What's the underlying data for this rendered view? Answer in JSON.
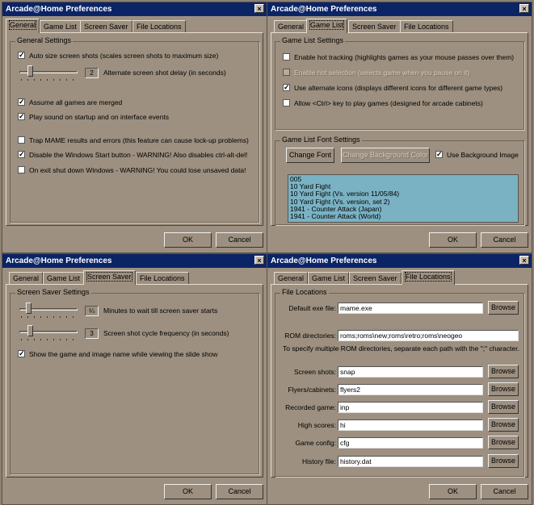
{
  "window_title": "Arcade@Home Preferences",
  "close_glyph": "×",
  "tabs": [
    "General",
    "Game List",
    "Screen Saver",
    "File Locations"
  ],
  "ok_label": "OK",
  "cancel_label": "Cancel",
  "general": {
    "group_title": "General Settings",
    "autosize": {
      "label": "Auto size screen shots (scales screen shots to maximum size)",
      "checked": true
    },
    "delay_value": "2",
    "delay_label": "Alternate screen shot delay (in seconds)",
    "merged": {
      "label": "Assume all games are merged",
      "checked": true
    },
    "sound": {
      "label": "Play sound on startup and on interface events",
      "checked": true
    },
    "trap": {
      "label": "Trap MAME results and errors (this feature can cause lock-up problems)",
      "checked": false
    },
    "winstart": {
      "label": "Disable the Windows Start button - WARNING! Also disables ctrl-alt-del!",
      "checked": true
    },
    "shutdown": {
      "label": "On exit shut down Windows - WARNING! You could lose unsaved data!",
      "checked": false
    }
  },
  "gamelist": {
    "group_title": "Game List Settings",
    "hot": {
      "label": "Enable hot tracking (highlights games as your mouse passes over them)",
      "checked": false
    },
    "hotsel": {
      "label": "Enable hot selection (selects game when you pause on it)",
      "checked": false
    },
    "icons": {
      "label": "Use alternate icons (displays different icons for different game types)",
      "checked": true
    },
    "ctrl": {
      "label": "Allow <Ctrl> key to play games (designed for arcade cabinets)",
      "checked": false
    },
    "font_group_title": "Game List Font Settings",
    "change_font": "Change Font",
    "change_bg": "Change Background Color",
    "use_bg": {
      "label": "Use Background Image",
      "checked": true
    },
    "font_list": [
      "005",
      "10 Yard Fight",
      "10 Yard Fight (Vs. version 11/05/84)",
      "10 Yard Fight (Vs. version, set 2)",
      "1941 - Counter Attack (Japan)",
      "1941 - Counter Attack (World)"
    ]
  },
  "screensaver": {
    "group_title": "Screen Saver Settings",
    "minutes_value": "¼",
    "minutes_label": "Minutes to wait till screen saver starts",
    "cycle_value": "3",
    "cycle_label": "Screen shot cycle frequency (in seconds)",
    "show": {
      "label": "Show the game and image name while viewing the slide show",
      "checked": true
    }
  },
  "filelocations": {
    "group_title": "File Locations",
    "browse": "Browse",
    "default_exe_label": "Default exe file:",
    "default_exe_value": "mame.exe",
    "rom_label": "ROM directories:",
    "rom_value": "roms;roms\\new;roms\\retro;roms\\neogeo",
    "rom_hint": "To specify multiple ROM directories, separate each path with the \";\" character.",
    "fields": [
      {
        "label": "Screen shots:",
        "value": "snap"
      },
      {
        "label": "Flyers/cabinets:",
        "value": "flyers2"
      },
      {
        "label": "Recorded game:",
        "value": "inp"
      },
      {
        "label": "High scores:",
        "value": "hi"
      },
      {
        "label": "Game config:",
        "value": "cfg"
      },
      {
        "label": "History file:",
        "value": "history.dat"
      }
    ]
  }
}
